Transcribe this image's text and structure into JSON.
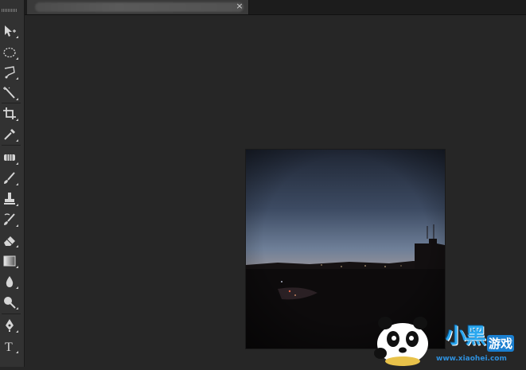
{
  "document_tab": {
    "title": "",
    "close_glyph": "×"
  },
  "toolbar": {
    "tools": [
      {
        "name": "move-tool",
        "icon": "move-icon"
      },
      {
        "name": "elliptical-marquee-tool",
        "icon": "ellipse-marquee-icon"
      },
      {
        "name": "polygonal-lasso-tool",
        "icon": "lasso-icon"
      },
      {
        "name": "magic-wand-tool",
        "icon": "magic-wand-icon"
      },
      {
        "name": "crop-tool",
        "icon": "crop-icon"
      },
      {
        "name": "eyedropper-tool",
        "icon": "eyedropper-icon"
      },
      {
        "name": "spot-healing-tool",
        "icon": "healing-icon"
      },
      {
        "name": "brush-tool",
        "icon": "brush-icon"
      },
      {
        "name": "clone-stamp-tool",
        "icon": "stamp-icon"
      },
      {
        "name": "history-brush-tool",
        "icon": "history-brush-icon"
      },
      {
        "name": "eraser-tool",
        "icon": "eraser-icon"
      },
      {
        "name": "gradient-tool",
        "icon": "gradient-icon"
      },
      {
        "name": "blur-tool",
        "icon": "blur-drop-icon"
      },
      {
        "name": "dodge-tool",
        "icon": "dodge-icon"
      },
      {
        "name": "pen-tool",
        "icon": "pen-icon"
      },
      {
        "name": "type-tool",
        "icon": "type-icon",
        "glyph": "T"
      }
    ]
  },
  "watermark": {
    "brand": "小黑",
    "suffix": "游戏",
    "url": "www.xiaohei.com"
  },
  "colors": {
    "workspace": "#262626",
    "toolbar": "#323232",
    "tab_active": "#3a3a3a",
    "watermark_blue": "#2aa8f0"
  }
}
